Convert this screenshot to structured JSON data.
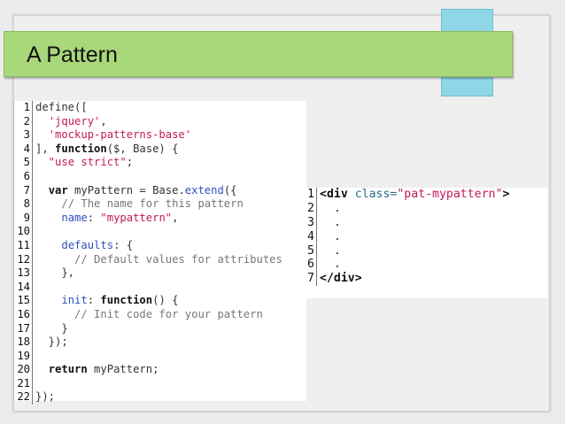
{
  "slide": {
    "title": "A Pattern"
  },
  "code_left": {
    "lines": [
      {
        "n": "1",
        "segments": [
          {
            "t": "define([",
            "k": "plain"
          }
        ]
      },
      {
        "n": "2",
        "segments": [
          {
            "t": "  ",
            "k": "plain"
          },
          {
            "t": "'jquery'",
            "k": "str"
          },
          {
            "t": ",",
            "k": "plain"
          }
        ]
      },
      {
        "n": "3",
        "segments": [
          {
            "t": "  ",
            "k": "plain"
          },
          {
            "t": "'mockup-patterns-base'",
            "k": "str"
          }
        ]
      },
      {
        "n": "4",
        "segments": [
          {
            "t": "], ",
            "k": "plain"
          },
          {
            "t": "function",
            "k": "kw"
          },
          {
            "t": "($, Base) {",
            "k": "plain"
          }
        ]
      },
      {
        "n": "5",
        "segments": [
          {
            "t": "  ",
            "k": "plain"
          },
          {
            "t": "\"use strict\"",
            "k": "str"
          },
          {
            "t": ";",
            "k": "plain"
          }
        ]
      },
      {
        "n": "6",
        "segments": [
          {
            "t": "",
            "k": "plain"
          }
        ]
      },
      {
        "n": "7",
        "segments": [
          {
            "t": "  ",
            "k": "plain"
          },
          {
            "t": "var",
            "k": "kw"
          },
          {
            "t": " myPattern = Base.",
            "k": "plain"
          },
          {
            "t": "extend",
            "k": "fn"
          },
          {
            "t": "({",
            "k": "plain"
          }
        ]
      },
      {
        "n": "8",
        "segments": [
          {
            "t": "    ",
            "k": "plain"
          },
          {
            "t": "// The name for this pattern",
            "k": "cm"
          }
        ]
      },
      {
        "n": "9",
        "segments": [
          {
            "t": "    ",
            "k": "plain"
          },
          {
            "t": "name",
            "k": "prop"
          },
          {
            "t": ": ",
            "k": "plain"
          },
          {
            "t": "\"mypattern\"",
            "k": "str"
          },
          {
            "t": ",",
            "k": "plain"
          }
        ]
      },
      {
        "n": "10",
        "segments": [
          {
            "t": "",
            "k": "plain"
          }
        ]
      },
      {
        "n": "11",
        "segments": [
          {
            "t": "    ",
            "k": "plain"
          },
          {
            "t": "defaults",
            "k": "prop"
          },
          {
            "t": ": {",
            "k": "plain"
          }
        ]
      },
      {
        "n": "12",
        "segments": [
          {
            "t": "      ",
            "k": "plain"
          },
          {
            "t": "// Default values for attributes",
            "k": "cm"
          }
        ]
      },
      {
        "n": "13",
        "segments": [
          {
            "t": "    },",
            "k": "plain"
          }
        ]
      },
      {
        "n": "14",
        "segments": [
          {
            "t": "",
            "k": "plain"
          }
        ]
      },
      {
        "n": "15",
        "segments": [
          {
            "t": "    ",
            "k": "plain"
          },
          {
            "t": "init",
            "k": "prop"
          },
          {
            "t": ": ",
            "k": "plain"
          },
          {
            "t": "function",
            "k": "kw"
          },
          {
            "t": "() {",
            "k": "plain"
          }
        ]
      },
      {
        "n": "16",
        "segments": [
          {
            "t": "      ",
            "k": "plain"
          },
          {
            "t": "// Init code for your pattern",
            "k": "cm"
          }
        ]
      },
      {
        "n": "17",
        "segments": [
          {
            "t": "    }",
            "k": "plain"
          }
        ]
      },
      {
        "n": "18",
        "segments": [
          {
            "t": "  });",
            "k": "plain"
          }
        ]
      },
      {
        "n": "19",
        "segments": [
          {
            "t": "",
            "k": "plain"
          }
        ]
      },
      {
        "n": "20",
        "segments": [
          {
            "t": "  ",
            "k": "plain"
          },
          {
            "t": "return",
            "k": "kw"
          },
          {
            "t": " myPattern;",
            "k": "plain"
          }
        ]
      },
      {
        "n": "21",
        "segments": [
          {
            "t": "",
            "k": "plain"
          }
        ]
      },
      {
        "n": "22",
        "segments": [
          {
            "t": "});",
            "k": "plain"
          }
        ]
      }
    ]
  },
  "code_right": {
    "lines": [
      {
        "n": "1",
        "segments": [
          {
            "t": "<div",
            "k": "kw"
          },
          {
            "t": " class=",
            "k": "attr"
          },
          {
            "t": "\"pat-mypattern\"",
            "k": "str"
          },
          {
            "t": ">",
            "k": "kw"
          }
        ]
      },
      {
        "n": "2",
        "segments": [
          {
            "t": "  .",
            "k": "plain"
          }
        ]
      },
      {
        "n": "3",
        "segments": [
          {
            "t": "  .",
            "k": "plain"
          }
        ]
      },
      {
        "n": "4",
        "segments": [
          {
            "t": "  .",
            "k": "plain"
          }
        ]
      },
      {
        "n": "5",
        "segments": [
          {
            "t": "  .",
            "k": "plain"
          }
        ]
      },
      {
        "n": "6",
        "segments": [
          {
            "t": "  .",
            "k": "plain"
          }
        ]
      },
      {
        "n": "7",
        "segments": [
          {
            "t": "</div>",
            "k": "kw"
          }
        ]
      }
    ]
  },
  "colors": {
    "title_bar": "#a8d87a",
    "accent_box": "#8fd6e6",
    "string": "#c2185b",
    "comment": "#777777",
    "property": "#3050c0"
  }
}
